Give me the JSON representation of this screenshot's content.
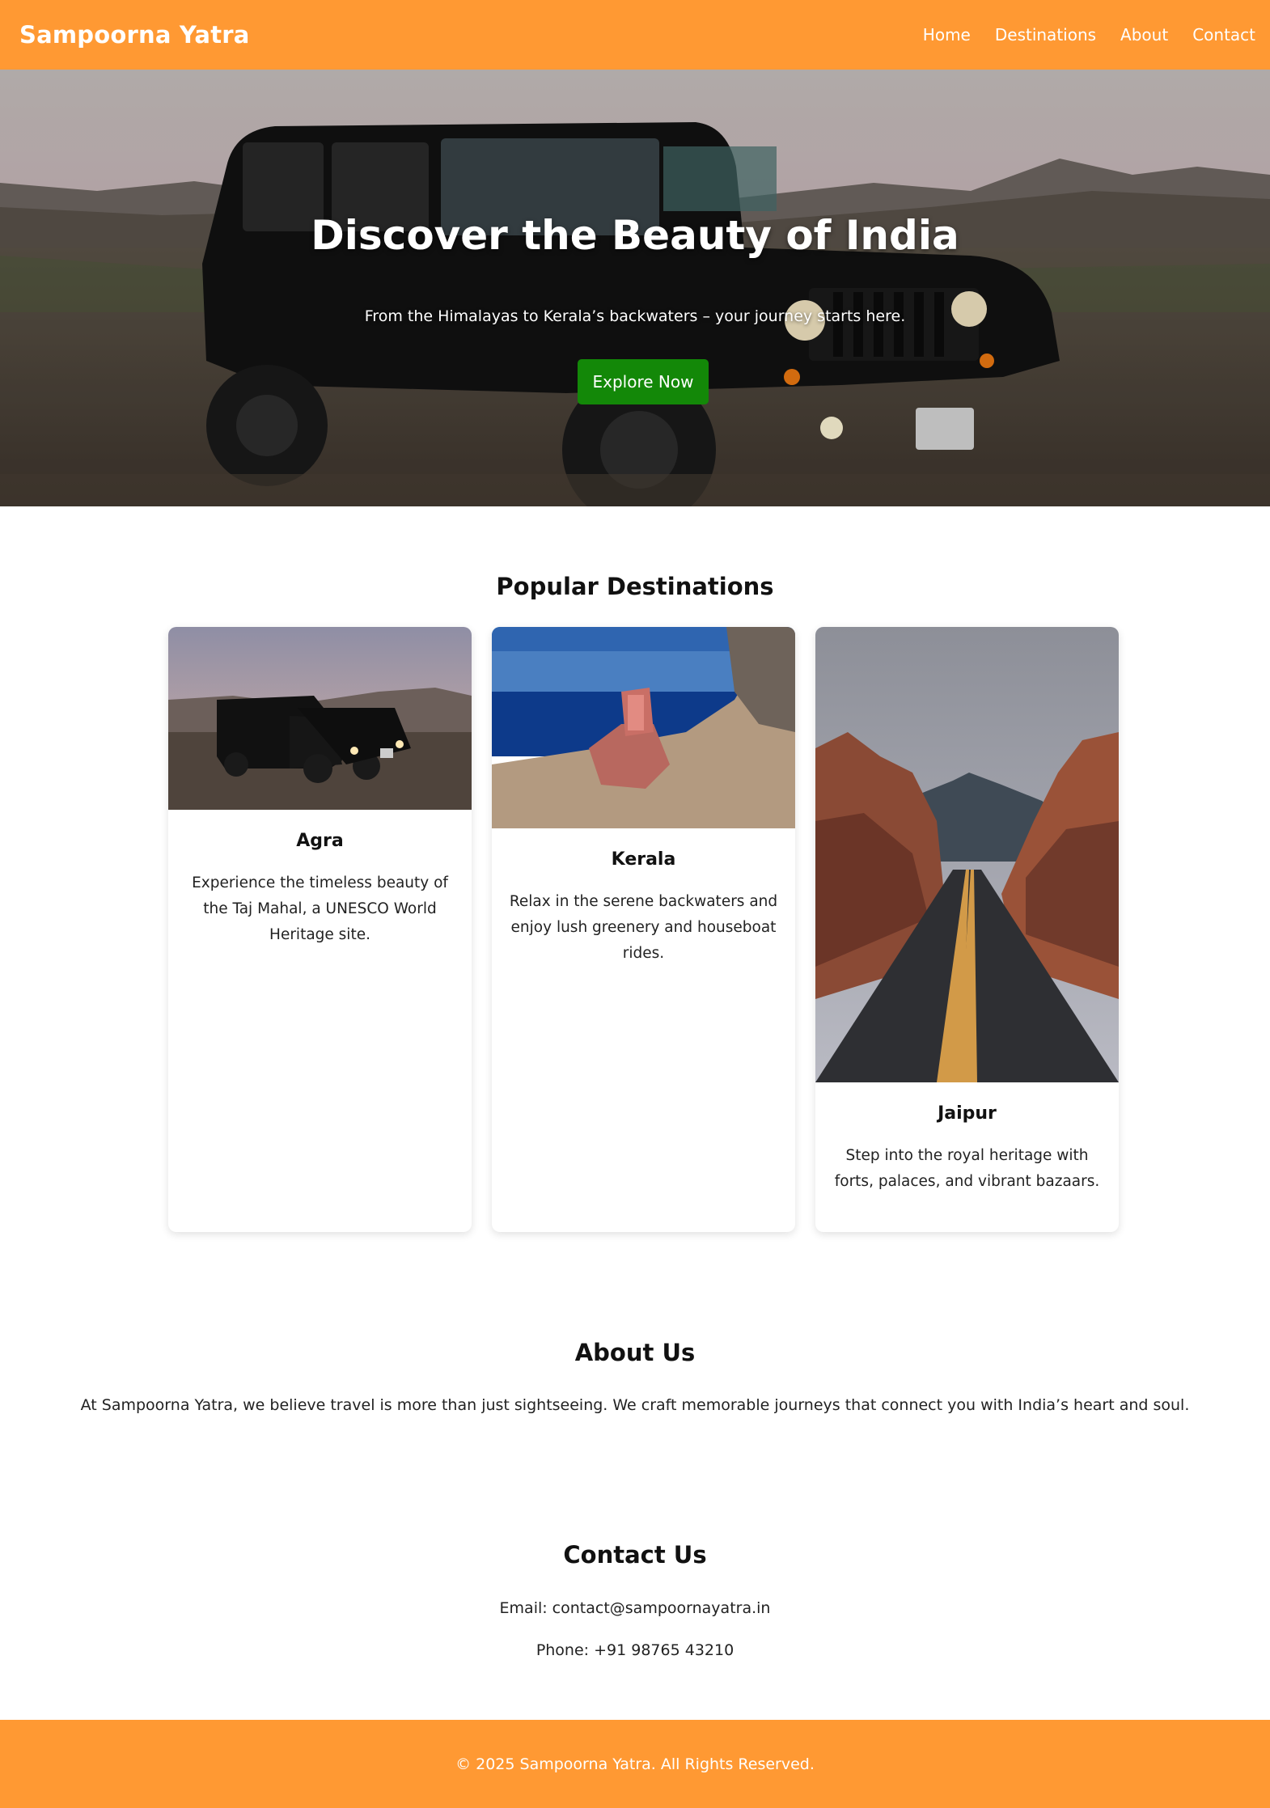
{
  "brand": "Sampoorna Yatra",
  "nav": [
    "Home",
    "Destinations",
    "About",
    "Contact"
  ],
  "hero": {
    "title": "Discover the Beauty of India",
    "subtitle": "From the Himalayas to Kerala’s backwaters – your journey starts here.",
    "button": "Explore Now"
  },
  "destinations": {
    "title": "Popular Destinations",
    "cards": [
      {
        "name": "Agra",
        "description": "Experience the timeless beauty of the Taj Mahal, a UNESCO World Heritage site."
      },
      {
        "name": "Kerala",
        "description": "Relax in the serene backwaters and enjoy lush greenery and houseboat rides."
      },
      {
        "name": "Jaipur",
        "description": "Step into the royal heritage with forts, palaces, and vibrant bazaars."
      }
    ]
  },
  "about": {
    "title": "About Us",
    "text": "At Sampoorna Yatra, we believe travel is more than just sightseeing. We craft memorable journeys that connect you with India’s heart and soul."
  },
  "contact": {
    "title": "Contact Us",
    "email": "Email: contact@sampoornayatra.in",
    "phone": "Phone: +91 98765 43210"
  },
  "footer": "© 2025 Sampoorna Yatra. All Rights Reserved.",
  "colors": {
    "saffron": "#ff9933",
    "green": "#138808"
  }
}
